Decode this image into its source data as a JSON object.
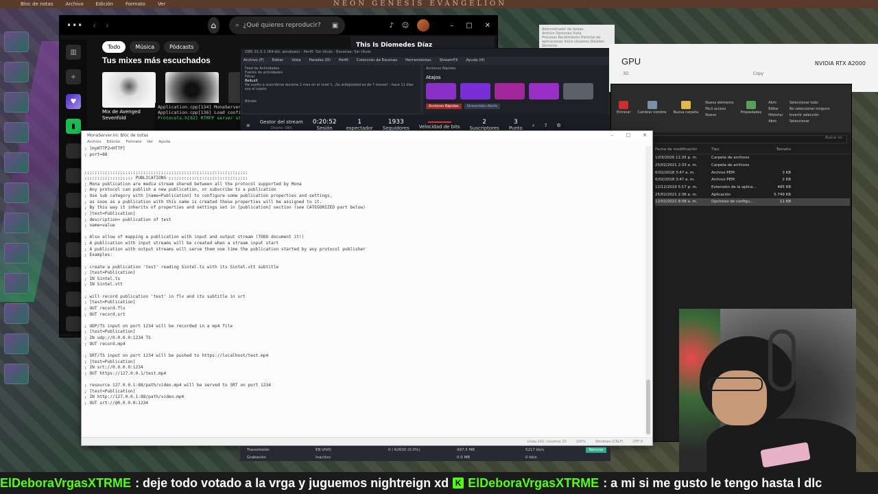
{
  "top_strip": {
    "notepad_label": "Bloc de notas",
    "menu": [
      "Archivo",
      "Edición",
      "Formato",
      "Ver"
    ],
    "eva_title": "NEON GENESIS EVANGELION"
  },
  "spotify": {
    "search_placeholder": "¿Qué quieres reproducir?",
    "chips": [
      "Todo",
      "Música",
      "Pódcasts"
    ],
    "heading": "Tus mixes más escuchados",
    "card1_caption": "Mix de Avenged Sevenfold",
    "banner": "This Is Diomedes Díaz"
  },
  "terminal": {
    "lines": [
      "Application.cpp[134] MonaServer (",
      "Application.cpp[136] Load config",
      "Protocols.h[82] RTMFP server sta"
    ]
  },
  "obs": {
    "title": "OBS 31.0.1 (64-bit, windows) - Perfil: Sin título - Escenas: Sin título",
    "menu": [
      "Archivo (F)",
      "Editar",
      "Vista",
      "Paneles (D)",
      "Perfil",
      "Colección de Escenas",
      "Herramientas",
      "StreamFX",
      "Ayuda (H)"
    ],
    "feed_title": "Feed de Actividades",
    "feed_source": "Fuente de actividades",
    "feed_filter": "Filtrar",
    "feed_user": "BeiluxX",
    "feed_msg": "Ha vuelto a suscribirse durante 1 mes en el nivel 1. ¡Su antigüedad es de 7 meses! - hace 11 días",
    "feed_sub": "soy el sujeto",
    "bitrate_label": "Bitrate",
    "quick_title": "Acciones Rápidas",
    "quick_heading": "Atajos",
    "quick_tabs": [
      "Acciones Rápidas",
      "Streamlabs Alerts"
    ],
    "status": {
      "stream_label": "Gestor del stream",
      "stream_sub": "Diseño: OBS",
      "session_time": "0:20:52",
      "session_label": "Sesión",
      "viewers": "1",
      "viewers_label": "espectador",
      "followers": "1933",
      "followers_label": "Seguidores",
      "bitrate_label": "Velocidad de bits",
      "subs": "2",
      "subs_label": "Suscriptores",
      "points": "3",
      "points_label": "Punto"
    }
  },
  "taskmgr": {
    "gpu": "GPU",
    "gpu_name": "NVIDIA RTX A2000",
    "small": "3D",
    "copy": "Copy",
    "back_title": "Administrador de tareas",
    "back_menu": "Archivo  Opciones  Vista",
    "back_tabs": "Procesos  Rendimiento  Historial de aplicaciones  Inicio  Usuarios  Detalles  Servicios"
  },
  "explorer": {
    "ribbon": {
      "delete": "Eliminar",
      "rename": "Cambiar nombre",
      "new_folder": "Nueva carpeta",
      "new_item": "Nuevo elemento",
      "easy_access": "Fácil acceso",
      "properties": "Propiedades",
      "open": "Abrir",
      "edit": "Editar",
      "history": "Historial",
      "select_all": "Seleccionar todo",
      "select_none": "No seleccionar ninguno",
      "invert": "Invertir selección",
      "group_new": "Nuevo",
      "group_open": "Abrir",
      "group_select": "Seleccionar"
    },
    "search_placeholder": "Buscar en",
    "columns": [
      "Fecha de modificación",
      "Tipo",
      "Tamaño"
    ],
    "rows": [
      {
        "date": "1/03/2026 11:35 p. m.",
        "type": "Carpeta de archivos",
        "size": ""
      },
      {
        "date": "25/02/2021 2:33 a. m.",
        "type": "Carpeta de archivos",
        "size": ""
      },
      {
        "date": "6/02/2018 3:47 a. m.",
        "type": "Archivo PEM",
        "size": "3 KB"
      },
      {
        "date": "6/02/2018 3:47 a. m.",
        "type": "Archivo PEM",
        "size": "2 KB"
      },
      {
        "date": "12/12/2019 5:17 p. m.",
        "type": "Extensión de la aplica...",
        "size": "485 KB"
      },
      {
        "date": "25/02/2021 2:36 a. m.",
        "type": "Aplicación",
        "size": "5.749 KB"
      },
      {
        "date": "12/02/2021 8:08 a. m.",
        "type": "Opciones de configu...",
        "size": "11 KB"
      }
    ]
  },
  "notepad": {
    "title": "MonaServer.ini: Bloc de notas",
    "menu": [
      "Archivo",
      "Edición",
      "Formato",
      "Ver",
      "Ayuda"
    ],
    "content": "; [myHTTP2=HTTP]\n; port=88\n\n\n;;;;;;;;;;;;;;;;;;;;;;;;;;;;;;;;;;;;;;;;;;;;;;;;;;;;;;;;;;;;;;;;\n;;;;;;;;;;;;;;;;;;; PUBLICATIONS ;;;;;;;;;;;;;;;;;;;;;;;;;;;;;;;\n; Mona publication are media stream shared between all the protocol supported by Mona\n; Any protocol can publish a new publication, or subscribe to a publication\n; Use sub category with [name=Publication] to configure some publication properties and settings,\n; as soon as a publication with this name is created these properties will be assigned to it.\n; By this way it inherits of properties and settings set in [publication] section (see CATEGORIZED part below)\n; [test=Publication]\n; description= publication of test\n; name=value\n\n; Also allow of mapping a publication with input and output stream (TODO document it!)\n; A publication with input streams will be created when a stream input start\n; A publication with output streams will serve them one time the publication started by any protocol publisher\n; Examples:\n\n; create a publication 'test' reading Sintel.ts with its Sintel.vtt subtitle\n; [test=Publication]\n; IN Sintel.ts\n; IN Sintel.vtt\n\n; will record publication 'test' in flv and its subtitle in srt\n; [test=Publication]\n; OUT record.flv\n; OUT record.srt\n\n; UDP/TS input on port 1234 will be recorded in a mp4 file\n; [test=Publication]\n; IN udp://0.0.0.0:1234 TS\n; OUT record.mp4\n\n; SRT/TS input on port 1234 will be pushed to https://localhost/test.mp4\n; [test=Publication]\n; IN srt://0.0.0.0:1234\n; OUT https://127.0.0.1/test.mp4\n\n; resource 127.0.0.1:88/path/video.mp4 will be served to SRT on port 1234\n; [test=Publication]\n; IN http://127.0.0.1:88/path/video.mp4\n; OUT srt://@0.0.0.0:1234",
    "status_line": "Línea 242, columna 10",
    "status_zoom": "100%",
    "status_eol": "Windows (CRLF)",
    "status_enc": "UTF-8"
  },
  "obs_stats": {
    "rows": [
      {
        "name": "Transmisión",
        "status": "EN VIVO",
        "dropped": "0 / 62630 (0.0%)",
        "data": "997.5 MB",
        "rate": "5217 kb/s"
      },
      {
        "name": "Grabación",
        "status": "Inactivo",
        "dropped": "",
        "data": "0.0 MB",
        "rate": "0 kb/s"
      }
    ],
    "reset_label": "Reiniciar"
  },
  "ticker": {
    "items": [
      {
        "user": "ElDeboraVrgasXTRME",
        "msg": ": deje todo votado a la vrga y juguemos nightreign xd"
      },
      {
        "user": "ElDeboraVrgasXTRME",
        "msg": ": a mi si me gusto le tengo hasta l dlc"
      }
    ]
  }
}
